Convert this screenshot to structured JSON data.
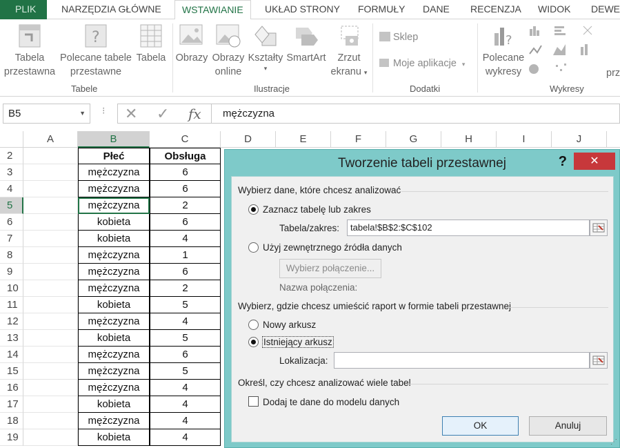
{
  "ribbon_tabs": [
    "PLIK",
    "NARZĘDZIA GŁÓWNE",
    "WSTAWIANIE",
    "UKŁAD STRONY",
    "FORMUŁY",
    "DANE",
    "RECENZJA",
    "WIDOK",
    "DEWE"
  ],
  "ribbon": {
    "pivot_table_l1": "Tabela",
    "pivot_table_l2": "przestawna",
    "recommended_l1": "Polecane tabele",
    "recommended_l2": "przestawne",
    "table": "Tabela",
    "group_tables": "Tabele",
    "pictures": "Obrazy",
    "online_l1": "Obrazy",
    "online_l2": "online",
    "shapes": "Kształty",
    "smartart": "SmartArt",
    "screenshot_l1": "Zrzut",
    "screenshot_l2": "ekranu",
    "group_illustrations": "Ilustracje",
    "store": "Sklep",
    "my_apps": "Moje aplikacje",
    "group_addins": "Dodatki",
    "rec_charts_l1": "Polecane",
    "rec_charts_l2": "wykresy",
    "group_charts": "Wykresy",
    "cut_text": "prz"
  },
  "formula_bar": {
    "name_box": "B5",
    "fx": "fx",
    "formula": "mężczyzna"
  },
  "columns": [
    "A",
    "B",
    "C",
    "D",
    "E",
    "F",
    "G",
    "H",
    "I",
    "J"
  ],
  "rows": [
    {
      "num": "2",
      "b": "Płeć",
      "c": "Obsługa"
    },
    {
      "num": "3",
      "b": "mężczyzna",
      "c": "6"
    },
    {
      "num": "4",
      "b": "mężczyzna",
      "c": "6"
    },
    {
      "num": "5",
      "b": "mężczyzna",
      "c": "2"
    },
    {
      "num": "6",
      "b": "kobieta",
      "c": "6"
    },
    {
      "num": "7",
      "b": "kobieta",
      "c": "4"
    },
    {
      "num": "8",
      "b": "mężczyzna",
      "c": "1"
    },
    {
      "num": "9",
      "b": "mężczyzna",
      "c": "6"
    },
    {
      "num": "10",
      "b": "mężczyzna",
      "c": "2"
    },
    {
      "num": "11",
      "b": "kobieta",
      "c": "5"
    },
    {
      "num": "12",
      "b": "mężczyzna",
      "c": "4"
    },
    {
      "num": "13",
      "b": "kobieta",
      "c": "5"
    },
    {
      "num": "14",
      "b": "mężczyzna",
      "c": "6"
    },
    {
      "num": "15",
      "b": "mężczyzna",
      "c": "5"
    },
    {
      "num": "16",
      "b": "mężczyzna",
      "c": "4"
    },
    {
      "num": "17",
      "b": "kobieta",
      "c": "4"
    },
    {
      "num": "18",
      "b": "mężczyzna",
      "c": "4"
    },
    {
      "num": "19",
      "b": "kobieta",
      "c": "4"
    }
  ],
  "dialog": {
    "title": "Tworzenie tabeli przestawnej",
    "help": "?",
    "close": "✕",
    "section1": "Wybierz dane, które chcesz analizować",
    "opt_select_table": "Zaznacz tabelę lub zakres",
    "range_label": "Tabela/zakres:",
    "range_value": "tabela!$B$2:$C$102",
    "opt_external": "Użyj zewnętrznego źródła danych",
    "choose_connection": "Wybierz połączenie...",
    "connection_name_label": "Nazwa połączenia:",
    "section2": "Wybierz, gdzie chcesz umieścić raport w formie tabeli przestawnej",
    "opt_new_sheet": "Nowy arkusz",
    "opt_existing_sheet": "Istniejący arkusz",
    "location_label": "Lokalizacja:",
    "location_value": "",
    "section3": "Określ, czy chcesz analizować wiele tabel",
    "add_to_model": "Dodaj te dane do modelu danych",
    "ok": "OK",
    "cancel": "Anuluj"
  },
  "colors": {
    "excel_green": "#217346",
    "dialog_frame": "#7ecac9",
    "close_red": "#c7383b"
  }
}
